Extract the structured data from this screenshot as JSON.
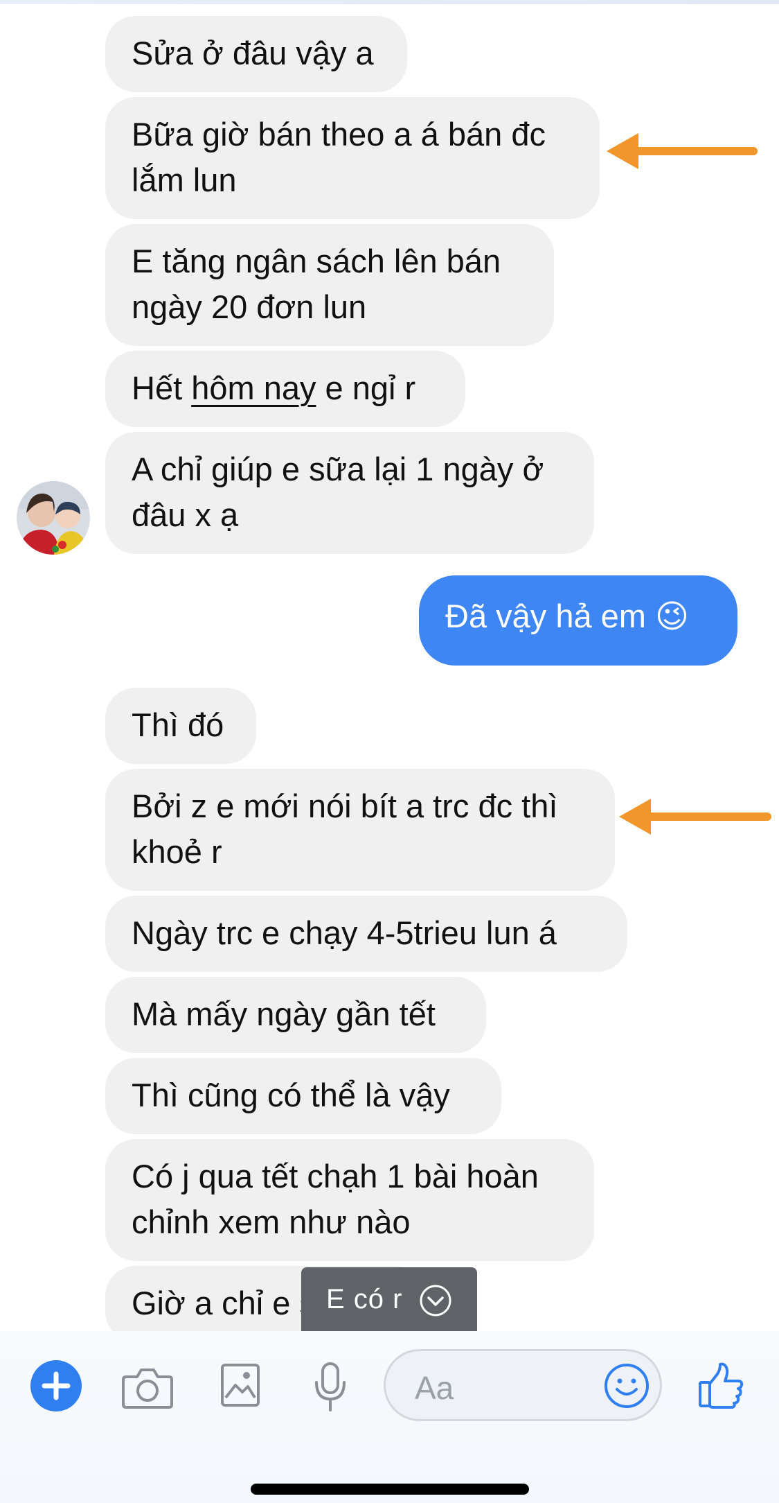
{
  "messages": [
    {
      "id": 1,
      "from": "them",
      "text": "Sửa ở đâu vậy a"
    },
    {
      "id": 2,
      "from": "them",
      "text": "Bữa giờ bán theo a á bán đc\nlắm lun"
    },
    {
      "id": 3,
      "from": "them",
      "text": "E tăng ngân sách lên bán\nngày 20 đơn lun"
    },
    {
      "id": 4,
      "from": "them",
      "parts": [
        "Hết ",
        "hôm nay",
        " e ngỉ r"
      ]
    },
    {
      "id": 5,
      "from": "them",
      "text": "A chỉ giúp e sữa lại 1 ngày ở\nđâu x ạ"
    },
    {
      "id": 6,
      "from": "me",
      "text": "Đã vậy hả em 😉"
    },
    {
      "id": 7,
      "from": "them",
      "text": "Thì đó"
    },
    {
      "id": 8,
      "from": "them",
      "text": "Bởi z e mới nói bít a trc đc thì\nkhoẻ r"
    },
    {
      "id": 9,
      "from": "them",
      "text": "Ngày trc e chạy 4-5trieu lun á"
    },
    {
      "id": 10,
      "from": "them",
      "text": "Mà mấy ngày gần tết"
    },
    {
      "id": 11,
      "from": "them",
      "text": "Thì cũng có thể là vậy"
    },
    {
      "id": 12,
      "from": "them",
      "text": "Có j qua tết chạh 1 bài hoàn\nchỉnh xem như nào"
    },
    {
      "id": 13,
      "from": "them",
      "text": "Giờ a chỉ e s"
    }
  ],
  "toast": {
    "text": "E có r",
    "icon": "chevron-down-icon"
  },
  "composer": {
    "placeholder": "Aa",
    "icons": [
      "plus-icon",
      "camera-icon",
      "image-icon",
      "microphone-icon",
      "emoji-icon",
      "thumbs-up-icon"
    ]
  },
  "annotations": {
    "arrow_color": "#f0962b"
  },
  "colors": {
    "my_bubble": "#3d86f4",
    "their_bubble": "#f0f0f0",
    "accent": "#2f7ff0"
  }
}
